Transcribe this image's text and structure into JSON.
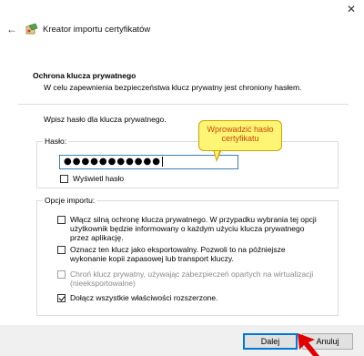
{
  "window": {
    "title": "Kreator importu certyfikatów",
    "close_glyph": "✕",
    "back_glyph": "←"
  },
  "section": {
    "title": "Ochrona klucza prywatnego",
    "subtitle": "W celu zapewnienia bezpieczeństwa klucz prywatny jest chroniony hasłem."
  },
  "instruction": "Wpisz hasło dla klucza prywatnego.",
  "password_group": {
    "label": "Hasło:",
    "value": "●●●●●●●●●●●",
    "show_password": {
      "label": "Wyświetl hasło",
      "checked": false
    }
  },
  "import_options": {
    "label": "Opcje importu:",
    "options": [
      {
        "label": "Włącz silną ochronę klucza prywatnego. W przypadku wybrania tej opcji użytkownik będzie informowany o każdym użyciu klucza prywatnego przez aplikację.",
        "checked": false,
        "disabled": false
      },
      {
        "label": "Oznacz ten klucz jako eksportowalny. Pozwoli to na późniejsze wykonanie kopii zapasowej lub transport kluczy.",
        "checked": false,
        "disabled": false
      },
      {
        "label": "Chroń klucz prywatny, używając zabezpieczeń opartych na wirtualizacji (nieeksportowalne)",
        "checked": false,
        "disabled": true
      },
      {
        "label": "Dołącz wszystkie właściwości rozszerzone.",
        "checked": true,
        "disabled": false
      }
    ]
  },
  "annotation": {
    "text": "Wprowadzić hasło certyfikatu",
    "color": "#c8480a",
    "background": "#fff574"
  },
  "buttons": {
    "next": "Dalej",
    "cancel": "Anuluj"
  },
  "colors": {
    "accent": "#0078d7",
    "arrow": "#e00000"
  }
}
